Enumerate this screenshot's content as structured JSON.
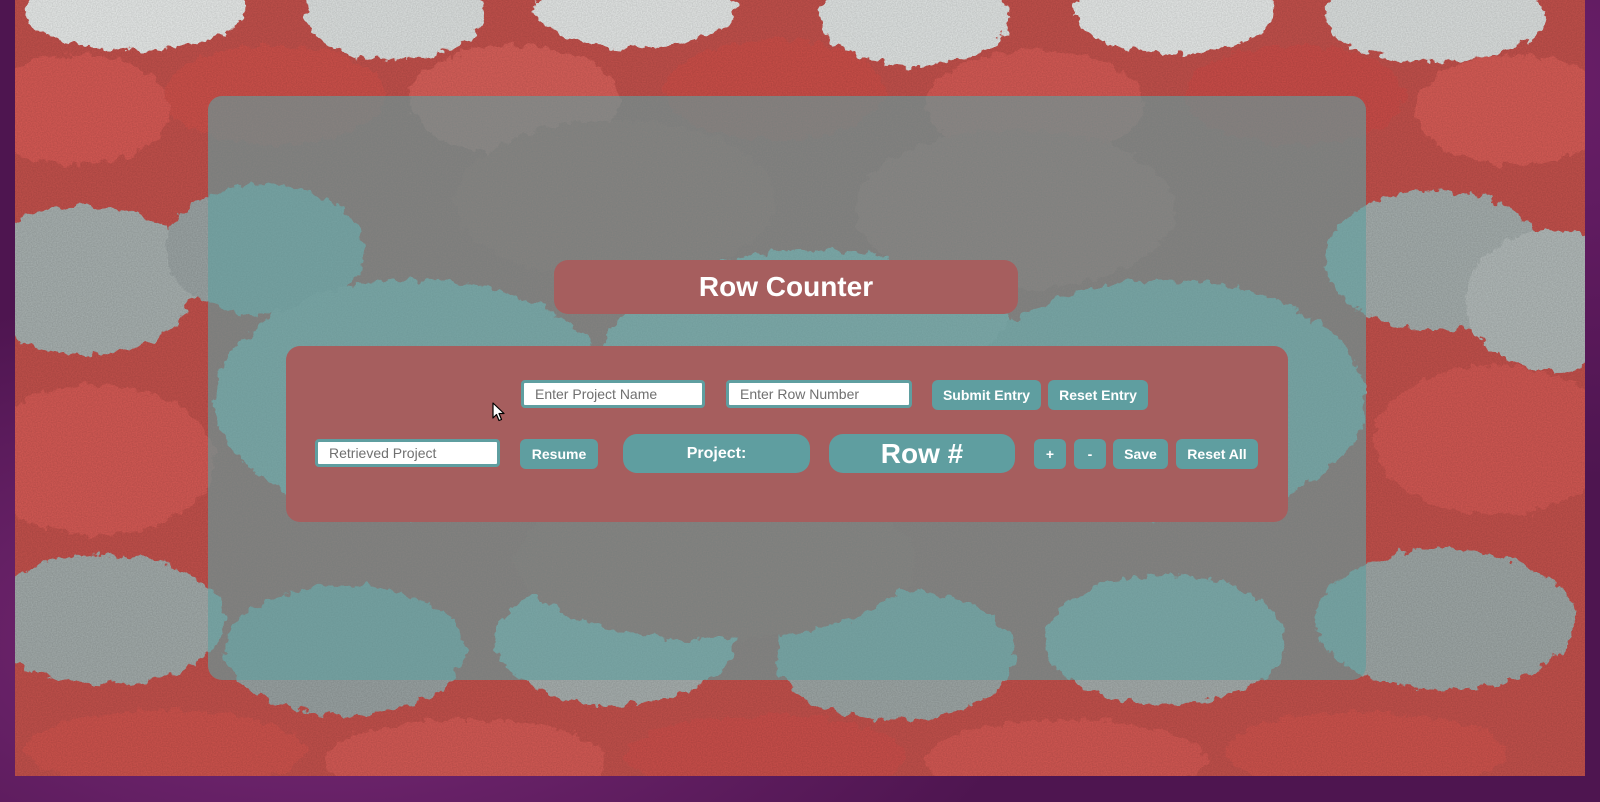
{
  "app": {
    "title": "Row Counter"
  },
  "entry": {
    "project_name_placeholder": "Enter Project Name",
    "row_number_placeholder": "Enter Row Number",
    "submit_label": "Submit Entry",
    "reset_label": "Reset Entry"
  },
  "retrieve": {
    "retrieved_placeholder": "Retrieved Project",
    "resume_label": "Resume"
  },
  "display": {
    "project_label": "Project:",
    "row_label": "Row #"
  },
  "counter": {
    "increment_label": "+",
    "decrement_label": "-",
    "save_label": "Save",
    "reset_all_label": "Reset All"
  },
  "colors": {
    "accent_teal": "#5f9ea0",
    "panel_rose": "#a65e5e",
    "frame_purple": "#4e1550"
  }
}
